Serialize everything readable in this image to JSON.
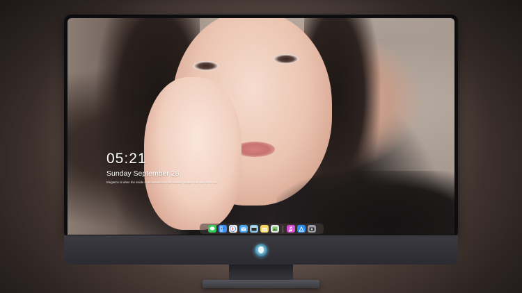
{
  "lock_screen": {
    "time": "05:21",
    "date": "Sunday September 28",
    "quote": "Elegance is when the inside is as beautiful as the outside, create your own style, let it be unique."
  },
  "dock": {
    "icons": [
      {
        "name": "messages-icon",
        "color": "#34c759"
      },
      {
        "name": "finder-icon",
        "color": "#3d8ef0"
      },
      {
        "name": "safari-icon",
        "color": "#f2f2f2"
      },
      {
        "name": "mail-icon",
        "color": "#4aa3ef"
      },
      {
        "name": "movie-icon",
        "color": "#8ecbe8"
      },
      {
        "name": "notes-icon",
        "color": "#f4d35e"
      },
      {
        "name": "photos-icon",
        "color": "#7ac36a"
      },
      {
        "name": "music-icon",
        "color": "#d64fd1"
      },
      {
        "name": "appstore-icon",
        "color": "#2f8df2"
      },
      {
        "name": "camera-icon",
        "color": "#9a9aa2"
      }
    ]
  }
}
